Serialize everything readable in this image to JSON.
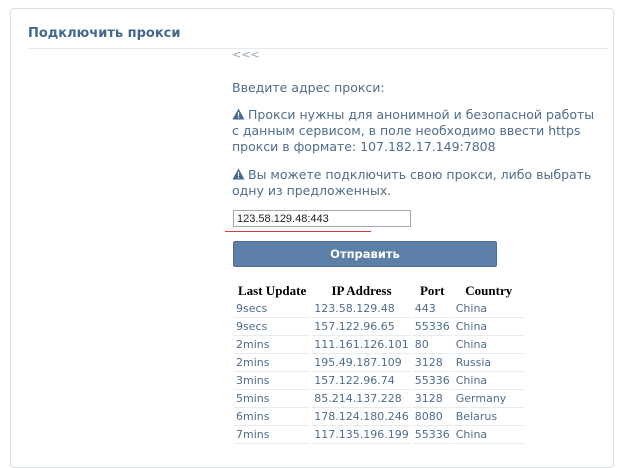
{
  "panel": {
    "title": "Подключить прокси",
    "back_link": "<<<",
    "prompt": "Введите адрес прокси:",
    "note1": "Прокси нужны для анонимной и безопасной работы с данным сервисом, в поле необходимо ввести https прокси в формате: 107.182.17.149:7808",
    "note2": "Вы можете подключить свою прокси, либо выбрать одну из предложенных.",
    "input_value": "123.58.129.48:443",
    "submit_label": "Отправить"
  },
  "table": {
    "headers": [
      "Last Update",
      "IP Address",
      "Port",
      "Country"
    ],
    "rows": [
      [
        "9secs",
        "123.58.129.48",
        "443",
        "China"
      ],
      [
        "9secs",
        "157.122.96.65",
        "55336",
        "China"
      ],
      [
        "2mins",
        "111.161.126.101",
        "80",
        "China"
      ],
      [
        "2mins",
        "195.49.187.109",
        "3128",
        "Russia"
      ],
      [
        "3mins",
        "157.122.96.74",
        "55336",
        "China"
      ],
      [
        "5mins",
        "85.214.137.228",
        "3128",
        "Germany"
      ],
      [
        "6mins",
        "178.124.180.246",
        "8080",
        "Belarus"
      ],
      [
        "7mins",
        "117.135.196.199",
        "55336",
        "China"
      ]
    ]
  },
  "colors": {
    "title": "#45688e",
    "text": "#4f6d8c",
    "button": "#5b7fa6",
    "underline": "#d8393b"
  },
  "icons": {
    "note": "warning-icon"
  }
}
